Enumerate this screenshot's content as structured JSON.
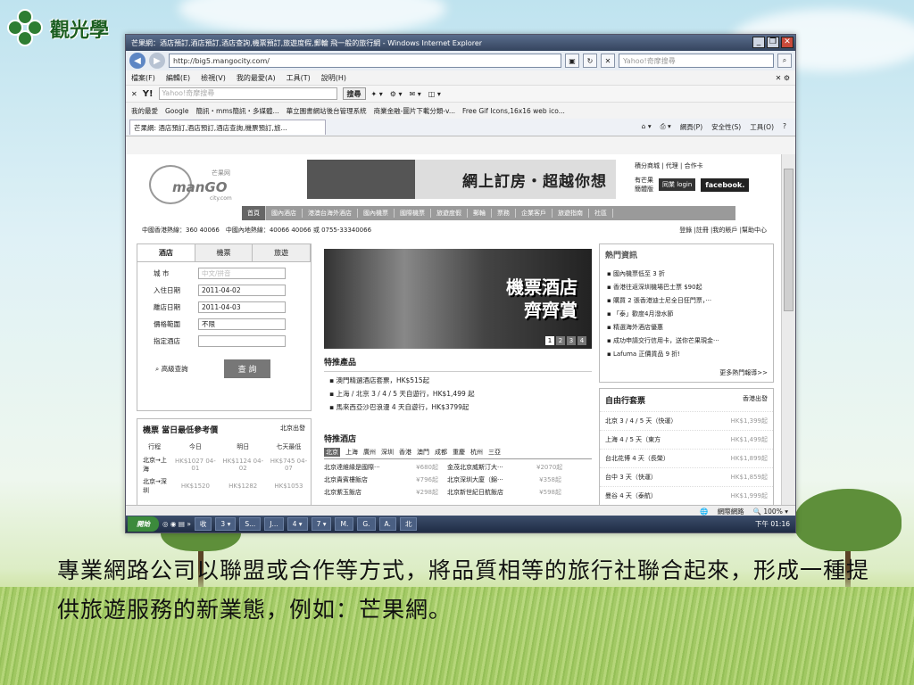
{
  "slide": {
    "logo_text": "觀光學",
    "caption": "專業網路公司以聯盟或合作等方式，將品質相等的旅行社聯合起來，形成一種提供旅遊服務的新業態，例如：芒果網。"
  },
  "browser": {
    "title": "芒果網：酒店預訂,酒店預訂,酒店查詢,機票預訂,旅遊度假,郵輪 飛一般的旅行網 - Windows Internet Explorer",
    "url": "http://big5.mangocity.com/",
    "search_placeholder": "Yahoo!奇摩搜尋",
    "menu": [
      "檔案(F)",
      "編輯(E)",
      "檢視(V)",
      "我的最愛(A)",
      "工具(T)",
      "說明(H)"
    ],
    "yahoo": {
      "logo": "Y!",
      "placeholder": "Yahoo!奇摩搜尋",
      "search_btn": "搜尋"
    },
    "favorites": [
      "我的最愛",
      "Google",
      "簡訊・mms簡訊・多媒體...",
      "華立園書網站後台管理系統",
      "商業金融-圖片下載分類-v...",
      "Free Gif Icons,16x16 web ico..."
    ],
    "tab": "芒果網: 酒店預訂,酒店預訂,酒店查詢,機票預訂,旅...",
    "tab_tools": [
      "網頁(P)",
      "安全性(S)",
      "工具(O)"
    ],
    "status": {
      "zone": "網際網路",
      "zoom": "100%"
    }
  },
  "page": {
    "logo": {
      "word": "manGO",
      "cn": "芒果网",
      "sub": "city.com"
    },
    "banner": "網上訂房・超越你想",
    "toplinks": "積分商城 | 代理 | 合作卡",
    "toplinks2": [
      "有芒果",
      "簡體版"
    ],
    "login": "同業 login",
    "facebook": "facebook.",
    "nav": [
      "首頁",
      "國內酒店",
      "港澳台海外酒店",
      "國內機票",
      "國際機票",
      "旅遊度假",
      "郵輪",
      "票務",
      "企業客戶",
      "旅遊指南",
      "社區"
    ],
    "hotline_left": "中國香港熱線：360 40066　中國內地熱線：40066 40066 或 0755-33340066",
    "hotline_right": "登錄 |註冊 |我的賬戶 |幫助中心",
    "book": {
      "tabs": [
        "酒店",
        "機票",
        "旅遊"
      ],
      "city_label": "城 市",
      "city_placeholder": "中文/拼音",
      "checkin_label": "入住日期",
      "checkin": "2011-04-02",
      "checkout_label": "離店日期",
      "checkout": "2011-04-03",
      "price_label": "價格範圍",
      "price": "不限",
      "hotel_label": "指定酒店",
      "adv": "高級查詢",
      "query": "查 詢"
    },
    "flight": {
      "title": "機票 當日最低參考價",
      "from": "北京出發",
      "headers": [
        "行程",
        "今日",
        "明日",
        "七天最低"
      ],
      "rows": [
        {
          "route": "北京→上海",
          "a": "HK$1027 04-01",
          "b": "HK$1124 04-02",
          "c": "HK$745 04-07"
        },
        {
          "route": "北京→深圳",
          "a": "HK$1520",
          "b": "HK$1282",
          "c": "HK$1053"
        }
      ]
    },
    "promo": {
      "line1": "機票酒店",
      "line2": "齊齊賞",
      "pages": [
        "1",
        "2",
        "3",
        "4"
      ]
    },
    "special": {
      "title": "特推產品",
      "items": [
        "澳門精選酒店套票，HK$515起",
        "上海 / 北京 3 / 4 / 5 天自遊行，HK$1,499 起",
        "馬來西亞沙巴浪漫 4 天自遊行，HK$3799起"
      ]
    },
    "hotels": {
      "title": "特推酒店",
      "cities": [
        "北京",
        "上海",
        "廣州",
        "深圳",
        "香港",
        "澳門",
        "成都",
        "重慶",
        "杭州",
        "三亞"
      ],
      "rows": [
        {
          "n1": "北京達維緣是國際···",
          "p1": "¥680起",
          "n2": "金茂北京威斯汀大···",
          "p2": "¥2070起"
        },
        {
          "n1": "北京貴賓樓飯店",
          "p1": "¥796起",
          "n2": "北京深圳大廈（錦···",
          "p2": "¥358起"
        },
        {
          "n1": "北京紫玉飯店",
          "p1": "¥298起",
          "n2": "北京新世紀日航飯店",
          "p2": "¥598起"
        }
      ]
    },
    "news": {
      "title": "熱門資訊",
      "items": [
        "國內機票低至 3 折",
        "香港往返深圳機場巴士票 $90起",
        "購買 2 張香港迪士尼全日狂門票，···",
        "「泰」歡度4月潑水節",
        "精選海外酒店優惠",
        "成功申請交行信用卡，送你芒果現金···",
        "Lafuma 正價貨品 9 折!"
      ],
      "more": "更多熱門報導>>"
    },
    "packages": {
      "title": "自由行套票",
      "from": "香港出發",
      "rows": [
        {
          "n": "北京 3 / 4 / 5 天（快運）",
          "p": "HK$1,399起"
        },
        {
          "n": "上海 4 / 5 天（東方",
          "p": "HK$1,499起"
        },
        {
          "n": "台北花博 4 天（長榮）",
          "p": "HK$1,899起"
        },
        {
          "n": "台中 3 天（快運）",
          "p": "HK$1,859起"
        },
        {
          "n": "曼谷 4 天（泰航）",
          "p": "HK$1,999起"
        }
      ]
    }
  },
  "taskbar": {
    "start": "開始",
    "items": [
      "收",
      "3 ▾",
      "S...",
      "J...",
      "4 ▾",
      "7 ▾",
      "M.",
      "G.",
      "A.",
      "北"
    ],
    "clock": "下午 01:16"
  }
}
